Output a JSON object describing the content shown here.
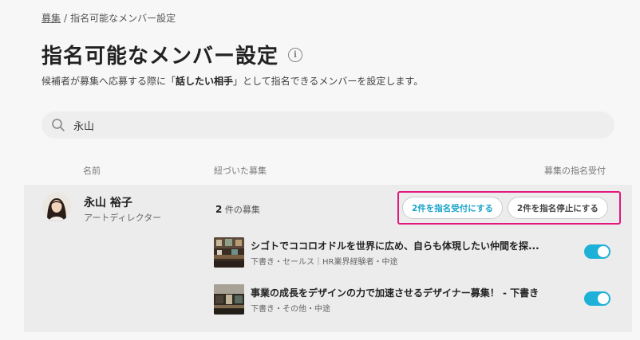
{
  "breadcrumb": {
    "parent": "募集",
    "separator": "/",
    "current": "指名可能なメンバー設定"
  },
  "page": {
    "title": "指名可能なメンバー設定",
    "info_icon": "info-icon",
    "description_before": "候補者が募集へ応募する際に「",
    "description_bold": "話したい相手",
    "description_after": "」として指名できるメンバーを設定します。"
  },
  "search": {
    "value": "永山",
    "placeholder": ""
  },
  "columns": {
    "name": "名前",
    "linked_recruitments": "紐づいた募集",
    "nomination": "募集の指名受付"
  },
  "member": {
    "name": "永山 裕子",
    "role": "アートディレクター",
    "recruit_count": "2",
    "recruit_suffix": "件の募集",
    "accept_all_label": "2件を指名受付にする",
    "stop_all_label": "2件を指名停止にする",
    "jobs": [
      {
        "title": "シゴトでココロオドルを世界に広め、自らも体現したい仲間を探...",
        "meta": "下書き・セールス｜HR業界経験者・中途",
        "nomination_enabled": true
      },
      {
        "title": "事業の成長をデザインの力で加速させるデザイナー募集！ - 下書き",
        "meta": "下書き・その他・中途",
        "nomination_enabled": true
      }
    ]
  },
  "colors": {
    "accent": "#1eb1d8",
    "highlight_border": "#e4177d",
    "panel_bg": "#ececec"
  }
}
